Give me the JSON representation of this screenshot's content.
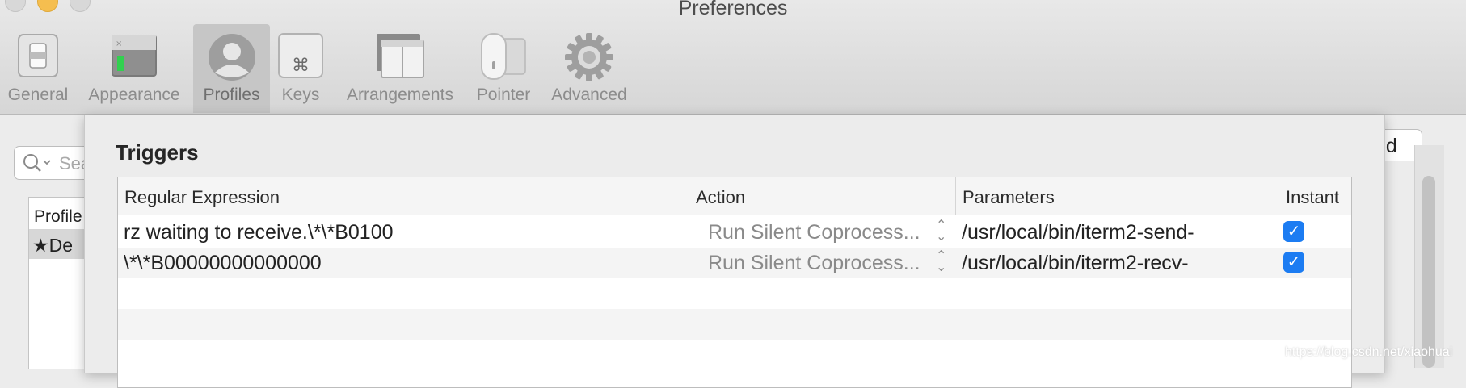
{
  "window": {
    "title": "Preferences"
  },
  "toolbar": {
    "items": [
      {
        "label": "General",
        "icon": "switch-icon",
        "selected": false
      },
      {
        "label": "Appearance",
        "icon": "window-icon",
        "selected": false
      },
      {
        "label": "Profiles",
        "icon": "person-icon",
        "selected": true
      },
      {
        "label": "Keys",
        "icon": "command-key-icon",
        "selected": false
      },
      {
        "label": "Arrangements",
        "icon": "windows-stack-icon",
        "selected": false
      },
      {
        "label": "Pointer",
        "icon": "mouse-icon",
        "selected": false
      },
      {
        "label": "Advanced",
        "icon": "gear-icon",
        "selected": false
      }
    ]
  },
  "background": {
    "search_placeholder": "Sea",
    "profiles_header": "Profile",
    "profile_row": "De",
    "button_partial": "ed",
    "watermark": "https://blog.csdn.net/xiaohuai"
  },
  "sheet": {
    "title": "Triggers",
    "columns": [
      "Regular Expression",
      "Action",
      "Parameters",
      "Instant"
    ],
    "rows": [
      {
        "regex": "rz waiting to receive.\\*\\*B0100",
        "action": "Run Silent Coprocess...",
        "parameters": "/usr/local/bin/iterm2-send-",
        "instant": true
      },
      {
        "regex": "\\*\\*B00000000000000",
        "action": "Run Silent Coprocess...",
        "parameters": "/usr/local/bin/iterm2-recv-",
        "instant": true
      }
    ]
  },
  "colors": {
    "accent": "#1c7cf2",
    "minimize": "#f5be4f"
  }
}
